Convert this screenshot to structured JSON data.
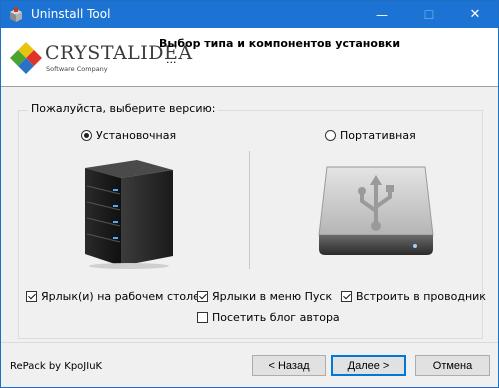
{
  "window": {
    "title": "Uninstall Tool",
    "app_icon": "box-icon",
    "controls": {
      "minimize": "—",
      "maximize": "☐",
      "close": "✕"
    }
  },
  "header": {
    "logo_word": "CRYSTALIDEA",
    "logo_sub": "Software Company",
    "title": "Выбор типа и компонентов установки",
    "subtitle": "..."
  },
  "version_group": {
    "label": "Пожалуйста, выберите версию:",
    "options": [
      {
        "label": "Установочная",
        "selected": true,
        "icon": "server-icon"
      },
      {
        "label": "Портативная",
        "selected": false,
        "icon": "usb-drive-icon"
      }
    ]
  },
  "checkboxes": [
    {
      "label": "Ярлык(и) на рабочем столе",
      "checked": true
    },
    {
      "label": "Ярлыки в меню Пуск",
      "checked": true
    },
    {
      "label": "Встроить в проводник",
      "checked": true
    },
    {
      "label": "Посетить блог автора",
      "checked": false
    }
  ],
  "footer": {
    "repack": "RePack by KpoJIuK",
    "back": "< Назад",
    "next": "Далее >",
    "cancel": "Отмена"
  },
  "colors": {
    "titlebar": "#1c73d3",
    "accent": "#0078d7"
  }
}
